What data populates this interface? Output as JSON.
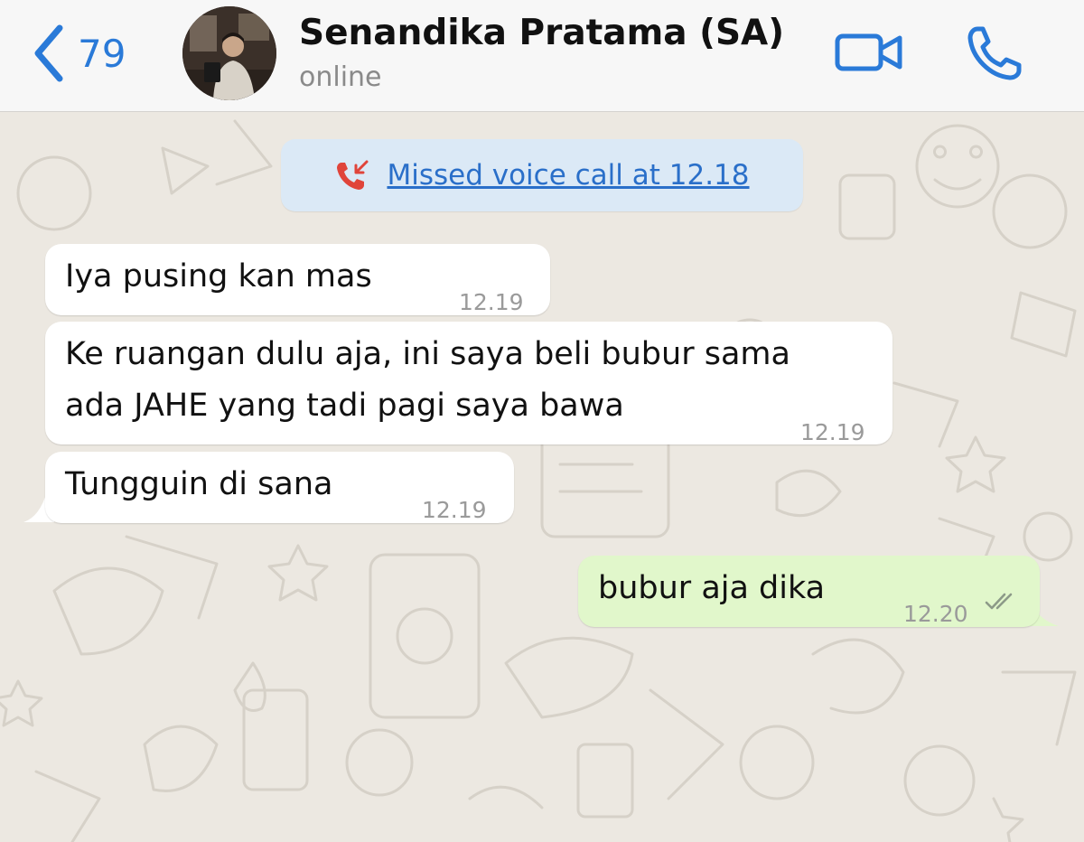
{
  "header": {
    "back_count": "79",
    "contact_name": "Senandika Pratama (SA)",
    "status": "online"
  },
  "system": {
    "missed_call": "Missed voice call at 12.18"
  },
  "messages": [
    {
      "direction": "incoming",
      "text": "Iya pusing kan mas",
      "time": "12.19"
    },
    {
      "direction": "incoming",
      "text": "Ke ruangan dulu aja, ini saya beli bubur sama\nada JAHE yang tadi pagi saya bawa",
      "time": "12.19"
    },
    {
      "direction": "incoming",
      "text": "Tungguin di sana",
      "time": "12.19"
    },
    {
      "direction": "outgoing",
      "text": "bubur aja dika",
      "time": "12.20",
      "status": "delivered"
    }
  ],
  "colors": {
    "accent": "#2a7ad8",
    "missed_call_red": "#e0443a",
    "incoming_bubble": "#ffffff",
    "outgoing_bubble": "#e1f7cb",
    "system_pill": "#dbe9f6",
    "wallpaper": "#ece8e1"
  },
  "icons": {
    "back": "chevron-left-icon",
    "video": "video-camera-icon",
    "call": "phone-icon",
    "missed": "missed-call-icon",
    "ticks": "double-check-icon"
  }
}
